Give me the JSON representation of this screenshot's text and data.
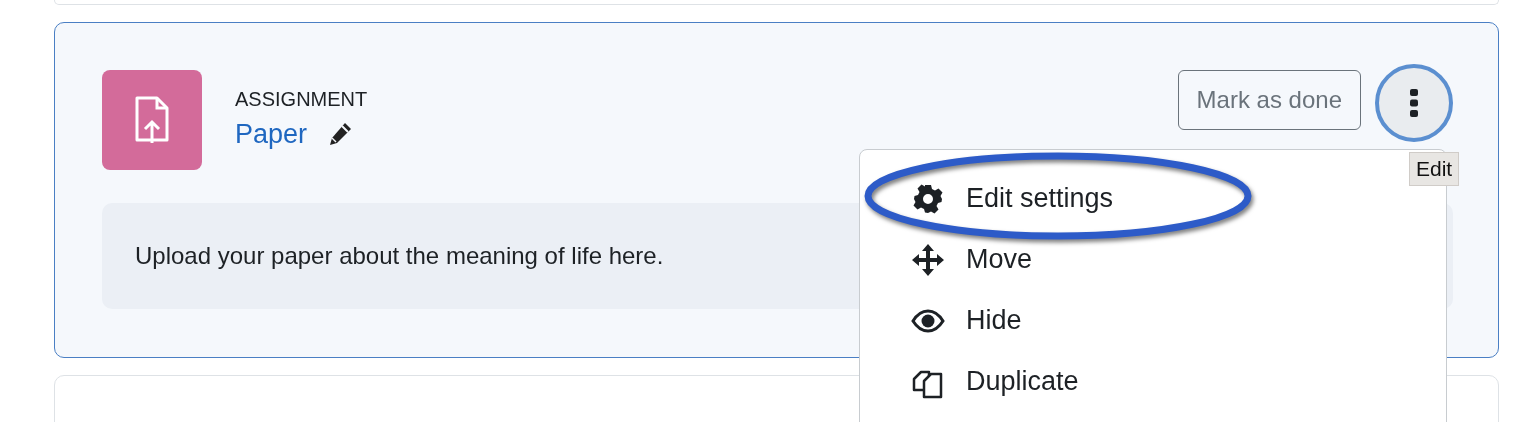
{
  "activity": {
    "type_label": "ASSIGNMENT",
    "name": "Paper",
    "description": "Upload your paper about the meaning of life here.",
    "mark_done_button": "Mark as done"
  },
  "actions_menu": {
    "open": true,
    "tooltip": "Edit",
    "items": [
      {
        "kind": "settings",
        "label": "Edit settings",
        "highlighted": true
      },
      {
        "kind": "move",
        "label": "Move",
        "highlighted": false
      },
      {
        "kind": "hide",
        "label": "Hide",
        "highlighted": false
      },
      {
        "kind": "duplicate",
        "label": "Duplicate",
        "highlighted": false
      }
    ]
  }
}
